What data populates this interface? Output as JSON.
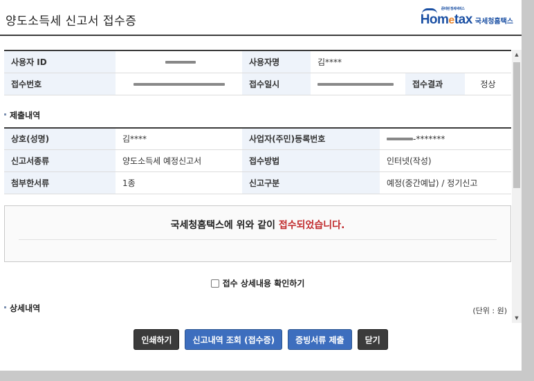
{
  "window": {
    "title": "양도소득세 신고서 접수증",
    "logo_tag": "준비된 정세서비스",
    "logo_brand_a": "Hom",
    "logo_brand_e": "e",
    "logo_brand_b": "tax",
    "logo_kr": "국세청홈택스"
  },
  "user_info": {
    "user_id_label": "사용자 ID",
    "user_name_label": "사용자명",
    "user_name_value": "김****",
    "receipt_no_label": "접수번호",
    "receipt_date_label": "접수일시",
    "result_label": "접수결과",
    "result_value": "정상"
  },
  "submission": {
    "heading": "제출내역",
    "trade_name_label": "상호(성명)",
    "trade_name_value": "김****",
    "reg_no_label": "사업자(주민)등록번호",
    "reg_no_value_suffix": "-*******",
    "report_type_label": "신고서종류",
    "report_type_value": "양도소득세 예정신고서",
    "method_label": "접수방법",
    "method_value": "인터넷(작성)",
    "attach_label": "첨부한서류",
    "attach_value": "1종",
    "category_label": "신고구분",
    "category_value": "예정(중간예납) / 정기신고"
  },
  "notice": {
    "text_before": "국세청홈택스에 위와 같이 ",
    "text_red": "접수되었습니다."
  },
  "confirm": {
    "label": "접수 상세내용 확인하기",
    "checked": false
  },
  "detail": {
    "heading": "상세내역",
    "unit": "(단위 : 원)"
  },
  "buttons": {
    "print": "인쇄하기",
    "view": "신고내역 조회 (접수증)",
    "evidence": "증빙서류 제출",
    "close": "닫기"
  }
}
